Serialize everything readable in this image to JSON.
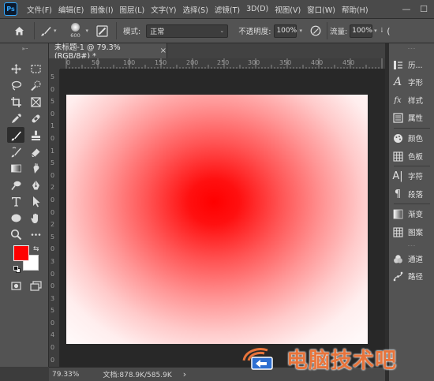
{
  "app": {
    "logo": "Ps"
  },
  "menu": [
    "文件(F)",
    "编辑(E)",
    "图像(I)",
    "图层(L)",
    "文字(Y)",
    "选择(S)",
    "滤镜(T)",
    "3D(D)",
    "视图(V)",
    "窗口(W)",
    "帮助(H)"
  ],
  "window_controls": {
    "minimize": "—",
    "maximize": "☐"
  },
  "options": {
    "brush_size": "600",
    "mode_label": "模式:",
    "mode_value": "正常",
    "opacity_label": "不透明度:",
    "opacity_value": "100%",
    "flow_label": "流量:",
    "flow_value": "100%"
  },
  "document": {
    "tab_title": "未标题-1 @ 79.3%(RGB/8#) *",
    "close_glyph": "×",
    "zoom": "79.33%",
    "doc_info": "文档:878.9K/585.9K",
    "status_arrow": "›"
  },
  "rulers": {
    "h": [
      "0",
      "50",
      "100",
      "150",
      "200",
      "250",
      "300",
      "350",
      "400",
      "450"
    ],
    "v": [
      "5",
      "0",
      "5",
      "0",
      "1",
      "0",
      "1",
      "5",
      "0",
      "2",
      "0",
      "0",
      "2",
      "5",
      "0",
      "3",
      "0",
      "0",
      "3",
      "5",
      "0",
      "4",
      "0",
      "0"
    ]
  },
  "colors": {
    "foreground": "#ff0000",
    "background": "#ffffff",
    "accent": "#31a8ff"
  },
  "panels": [
    {
      "icon": "history-icon",
      "label": "历..."
    },
    {
      "icon": "character-icon",
      "label": "字形"
    },
    {
      "icon": "styles-icon",
      "label": "样式"
    },
    {
      "icon": "properties-icon",
      "label": "属性"
    },
    {
      "icon": "color-icon",
      "label": "颜色"
    },
    {
      "icon": "swatches-icon",
      "label": "色板"
    },
    {
      "icon": "type-icon",
      "label": "字符"
    },
    {
      "icon": "paragraph-icon",
      "label": "段落"
    },
    {
      "icon": "gradient-icon",
      "label": "渐变"
    },
    {
      "icon": "patterns-icon",
      "label": "图案"
    },
    {
      "icon": "channels-icon",
      "label": "通道"
    },
    {
      "icon": "paths-icon",
      "label": "路径"
    }
  ],
  "watermark": {
    "text": "电脑技术吧"
  }
}
